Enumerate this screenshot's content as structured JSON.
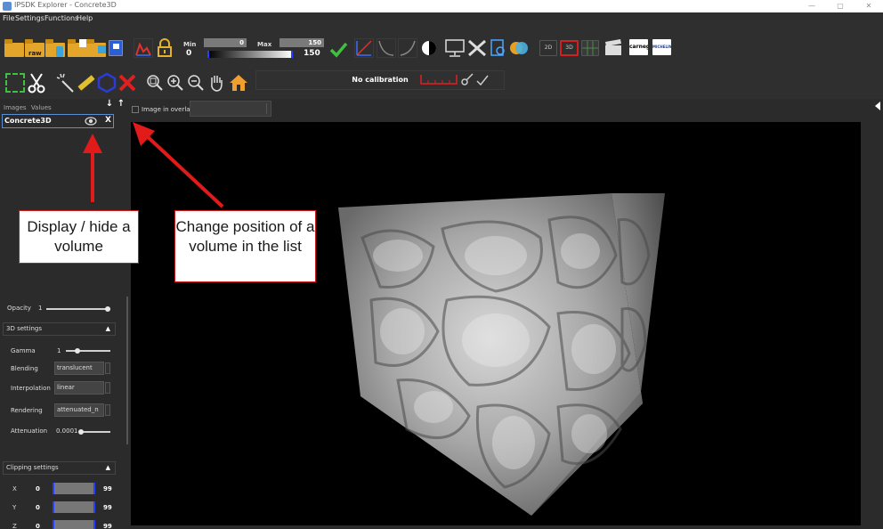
{
  "window": {
    "title": "IPSDK Explorer - Concrete3D"
  },
  "menu": {
    "items": [
      "File",
      "Settings",
      "Functions",
      "Help"
    ]
  },
  "toolbar": {
    "raw_label": "raw",
    "min_label": "Min",
    "max_label": "Max",
    "min_box_value": "0",
    "max_box_value": "150",
    "min_value": "0",
    "max_value": "150",
    "btn_2d": "2D",
    "btn_3d": "3D",
    "logo_carnegie": "carneg",
    "logo_michelin": "MICHELIN",
    "calibration_text": "No calibration"
  },
  "left_panel": {
    "tabs": [
      "Images",
      "Values"
    ],
    "image_name": "Concrete3D",
    "remove_label": "X",
    "opacity_label": "Opacity",
    "opacity_value": "1",
    "settings_3d_label": "3D settings",
    "gamma_label": "Gamma",
    "gamma_value": "1",
    "blending_label": "Blending",
    "blending_value": "translucent",
    "interpolation_label": "Interpolation",
    "interpolation_value": "linear",
    "rendering_label": "Rendering",
    "rendering_value": "attenuated_n",
    "attenuation_label": "Attenuation",
    "attenuation_value": "0.0001",
    "clipping_label": "Clipping settings",
    "clipping": [
      {
        "axis": "X",
        "min": "0",
        "max": "99"
      },
      {
        "axis": "Y",
        "min": "0",
        "max": "99"
      },
      {
        "axis": "Z",
        "min": "0",
        "max": "99"
      }
    ]
  },
  "overlay": {
    "label": "Image in overlay"
  },
  "callouts": {
    "display_hide": "Display / hide a volume",
    "change_position": "Change position of a volume in the list"
  },
  "colors": {
    "accent": "#5b8fd3",
    "callout_red": "#e11a1a",
    "folder": "#e3a52a"
  }
}
